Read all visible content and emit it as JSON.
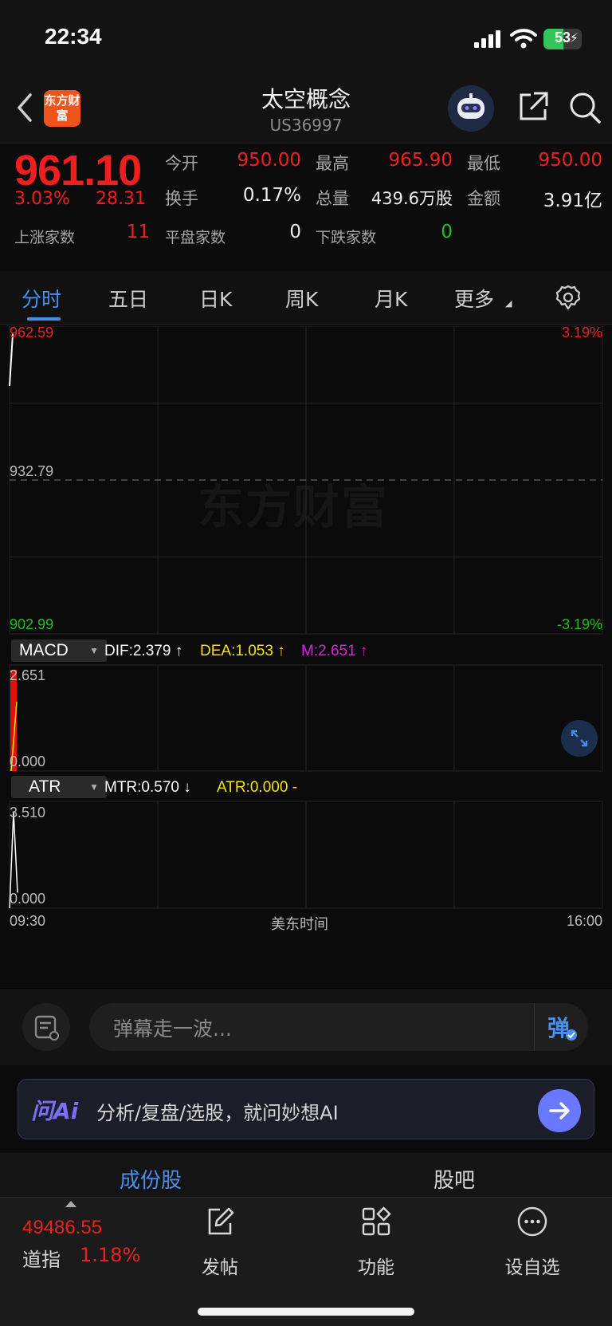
{
  "status_bar": {
    "time": "22:34",
    "battery": "53",
    "battery_level": 0.53
  },
  "header": {
    "title": "太空概念",
    "code": "US36997",
    "logo_text": "东方财富"
  },
  "quote": {
    "price": "961.10",
    "change_pct": "3.03%",
    "change": "28.31",
    "open_label": "今开",
    "open": "950.00",
    "high_label": "最高",
    "high": "965.90",
    "low_label": "最低",
    "low": "950.00",
    "turnover_label": "换手",
    "turnover": "0.17%",
    "volume_label": "总量",
    "volume": "439.6万股",
    "amount_label": "金额",
    "amount": "3.91亿",
    "up_label": "上涨家数",
    "up_count": "11",
    "flat_label": "平盘家数",
    "flat_count": "0",
    "down_label": "下跌家数",
    "down_count": "0"
  },
  "tabs": [
    {
      "label": "分时",
      "active": true
    },
    {
      "label": "五日"
    },
    {
      "label": "日K"
    },
    {
      "label": "周K"
    },
    {
      "label": "月K"
    },
    {
      "label": "更多"
    }
  ],
  "chart_data": [
    {
      "type": "line",
      "name": "intraday",
      "ylim": [
        902.99,
        962.59
      ],
      "y_labels": {
        "top": "962.59",
        "mid": "932.79",
        "bottom": "902.99"
      },
      "pct_labels": {
        "top": "3.19%",
        "bottom": "-3.19%"
      },
      "x_labels": {
        "start": "09:30",
        "mid": "美东时间",
        "end": "16:00"
      },
      "series": [
        {
          "values": [
            951.0,
            961.1
          ]
        }
      ]
    },
    {
      "type": "bar",
      "name": "MACD",
      "indicator": "MACD",
      "ylim": [
        0.0,
        2.651
      ],
      "y_labels": {
        "top": "2.651",
        "bottom": "0.000"
      },
      "readouts": [
        {
          "text": "DIF:2.379 ↑",
          "color": "#ffffff"
        },
        {
          "text": "DEA:1.053 ↑",
          "color": "#f5e400"
        },
        {
          "text": "M:2.651 ↑",
          "color": "#e020e0"
        }
      ],
      "values": [
        2.651
      ]
    },
    {
      "type": "line",
      "name": "ATR",
      "indicator": "ATR",
      "ylim": [
        0.0,
        3.51
      ],
      "y_labels": {
        "top": "3.510",
        "bottom": "0.000"
      },
      "readouts": [
        {
          "text": "MTR:0.570 ↓",
          "color": "#ffffff"
        },
        {
          "text": "ATR:0.000 -",
          "color": "#f5e400"
        }
      ],
      "series": [
        {
          "values": [
            0.0,
            3.51,
            0.57
          ]
        }
      ]
    }
  ],
  "danmu": {
    "placeholder": "弹幕走一波...",
    "button": "弹"
  },
  "ai": {
    "brand": "问Ai",
    "text": "分析/复盘/选股，就问妙想AI"
  },
  "sub_tabs": [
    {
      "label": "成份股",
      "active": true
    },
    {
      "label": "股吧"
    }
  ],
  "bottom": {
    "index_value": "49486.55",
    "index_name": "道指",
    "index_pct": "1.18%",
    "nav": [
      {
        "label": "发帖",
        "icon": "edit-icon"
      },
      {
        "label": "功能",
        "icon": "grid-icon"
      },
      {
        "label": "设自选",
        "icon": "more-icon"
      }
    ]
  },
  "colors": {
    "up": "#f01f1f",
    "down": "#1ac21a",
    "accent": "#4a8eec"
  }
}
